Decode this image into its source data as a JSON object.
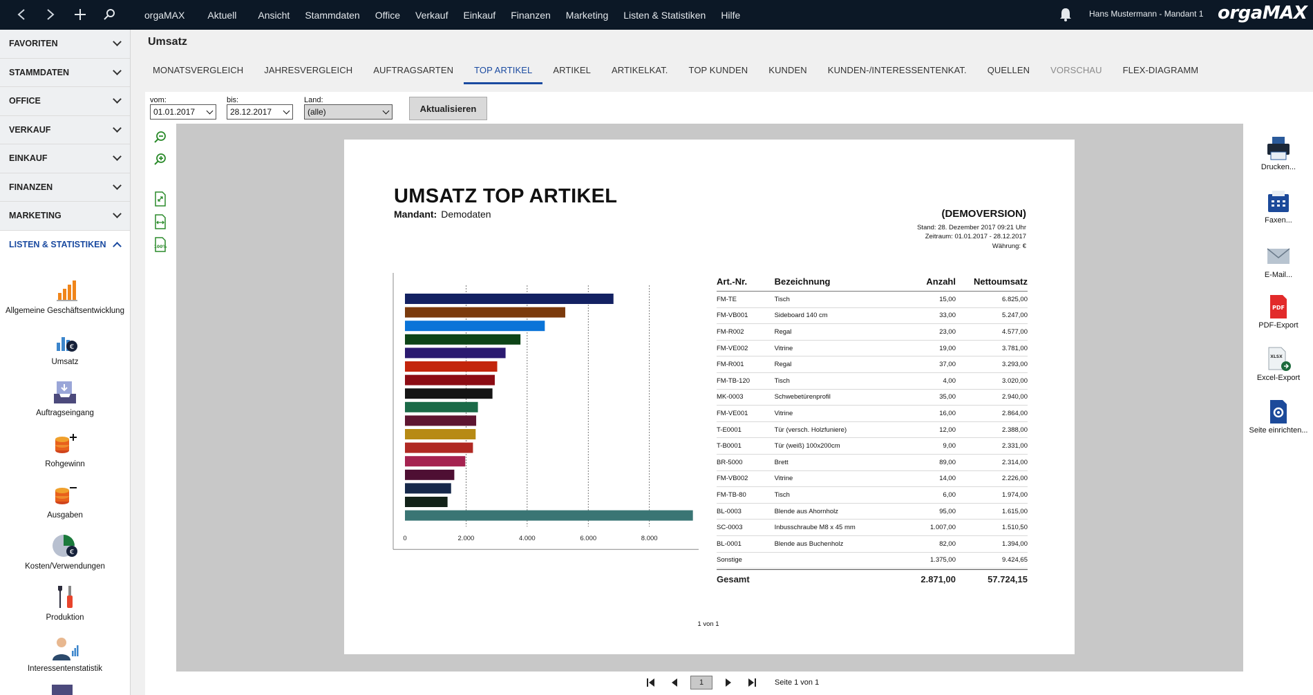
{
  "topbar": {
    "menu": [
      "orgaMAX",
      "Aktuell",
      "Ansicht",
      "Stammdaten",
      "Office",
      "Verkauf",
      "Einkauf",
      "Finanzen",
      "Marketing",
      "Listen & Statistiken",
      "Hilfe"
    ],
    "user": "Hans Mustermann - Mandant 1",
    "logo_a": "orga",
    "logo_b": "MAX"
  },
  "sidebar": {
    "sections": [
      "FAVORITEN",
      "STAMMDATEN",
      "OFFICE",
      "VERKAUF",
      "EINKAUF",
      "FINANZEN",
      "MARKETING",
      "LISTEN & STATISTIKEN"
    ],
    "items": [
      "Allgemeine Geschäftsentwicklung",
      "Umsatz",
      "Auftragseingang",
      "Rohgewinn",
      "Ausgaben",
      "Kosten/Verwendungen",
      "Produktion",
      "Interessentenstatistik"
    ]
  },
  "page": {
    "title": "Umsatz",
    "tabs": [
      "MONATSVERGLEICH",
      "JAHRESVERGLEICH",
      "AUFTRAGSARTEN",
      "TOP ARTIKEL",
      "ARTIKEL",
      "ARTIKELKAT.",
      "TOP KUNDEN",
      "KUNDEN",
      "KUNDEN-/INTERESSENTENKAT.",
      "QUELLEN",
      "VORSCHAU",
      "FLEX-DIAGRAMM"
    ],
    "active_tab": "TOP ARTIKEL"
  },
  "filters": {
    "from_label": "vom:",
    "from_value": "01.01.2017",
    "to_label": "bis:",
    "to_value": "28.12.2017",
    "land_label": "Land:",
    "land_value": "(alle)",
    "update_button": "Aktualisieren"
  },
  "report": {
    "title": "UMSATZ TOP ARTIKEL",
    "mandant_label": "Mandant:",
    "mandant_value": "Demodaten",
    "demo": "(DEMOVERSION)",
    "stand": "Stand:  28. Dezember 2017 09:21 Uhr",
    "zeitraum": "Zeitraum: 01.01.2017 - 28.12.2017",
    "waehrung": "Währung: €",
    "page_count": "1 von 1",
    "table_headers": [
      "Art.-Nr.",
      "Bezeichnung",
      "Anzahl",
      "Nettoumsatz"
    ],
    "rows": [
      [
        "FM-TE",
        "Tisch",
        "15,00",
        "6.825,00"
      ],
      [
        "FM-VB001",
        "Sideboard 140 cm",
        "33,00",
        "5.247,00"
      ],
      [
        "FM-R002",
        "Regal",
        "23,00",
        "4.577,00"
      ],
      [
        "FM-VE002",
        "Vitrine",
        "19,00",
        "3.781,00"
      ],
      [
        "FM-R001",
        "Regal",
        "37,00",
        "3.293,00"
      ],
      [
        "FM-TB-120",
        "Tisch",
        "4,00",
        "3.020,00"
      ],
      [
        "MK-0003",
        "Schwebetürenprofil",
        "35,00",
        "2.940,00"
      ],
      [
        "FM-VE001",
        "Vitrine",
        "16,00",
        "2.864,00"
      ],
      [
        "T-E0001",
        "Tür (versch. Holzfuniere)",
        "12,00",
        "2.388,00"
      ],
      [
        "T-B0001",
        "Tür (weiß) 100x200cm",
        "9,00",
        "2.331,00"
      ],
      [
        "BR-5000",
        "Brett",
        "89,00",
        "2.314,00"
      ],
      [
        "FM-VB002",
        "Vitrine",
        "14,00",
        "2.226,00"
      ],
      [
        "FM-TB-80",
        "Tisch",
        "6,00",
        "1.974,00"
      ],
      [
        "BL-0003",
        "Blende aus Ahornholz",
        "95,00",
        "1.615,00"
      ],
      [
        "SC-0003",
        "Inbusschraube M8 x 45 mm",
        "1.007,00",
        "1.510,50"
      ],
      [
        "BL-0001",
        "Blende aus Buchenholz",
        "82,00",
        "1.394,00"
      ],
      [
        "Sonstige",
        "",
        "1.375,00",
        "9.424,65"
      ]
    ],
    "total_label": "Gesamt",
    "total_anzahl": "2.871,00",
    "total_umsatz": "57.724,15"
  },
  "chart_data": {
    "type": "bar",
    "orientation": "horizontal",
    "categories": [
      "FM-TE",
      "FM-VB001",
      "FM-R002",
      "FM-VE002",
      "FM-R001",
      "FM-TB-120",
      "MK-0003",
      "FM-VE001",
      "T-E0001",
      "T-B0001",
      "BR-5000",
      "FM-VB002",
      "FM-TB-80",
      "BL-0003",
      "SC-0003",
      "BL-0001",
      "Sonstige"
    ],
    "values": [
      6825,
      5247,
      4577,
      3781,
      3293,
      3020,
      2940,
      2864,
      2388,
      2331,
      2314,
      2226,
      1974,
      1615,
      1510.5,
      1394,
      9424.65
    ],
    "colors": [
      "#132162",
      "#7b3a0c",
      "#0a74d8",
      "#0d4417",
      "#2b1a70",
      "#c3250c",
      "#8c0c14",
      "#151515",
      "#1b6a48",
      "#5e1531",
      "#b78a14",
      "#b02923",
      "#a52250",
      "#4e0f33",
      "#16284a",
      "#122218",
      "#3a7574"
    ],
    "xlim": [
      0,
      9500
    ],
    "x_ticks": [
      "0",
      "2.000",
      "4.000",
      "6.000",
      "8.000"
    ],
    "x_tick_values": [
      0,
      2000,
      4000,
      6000,
      8000
    ],
    "grid": true
  },
  "actions": [
    "Drucken...",
    "Faxen...",
    "E-Mail...",
    "PDF-Export",
    "Excel-Export",
    "Seite einrichten..."
  ],
  "pager": {
    "current": "1",
    "info": "Seite 1 von 1"
  }
}
